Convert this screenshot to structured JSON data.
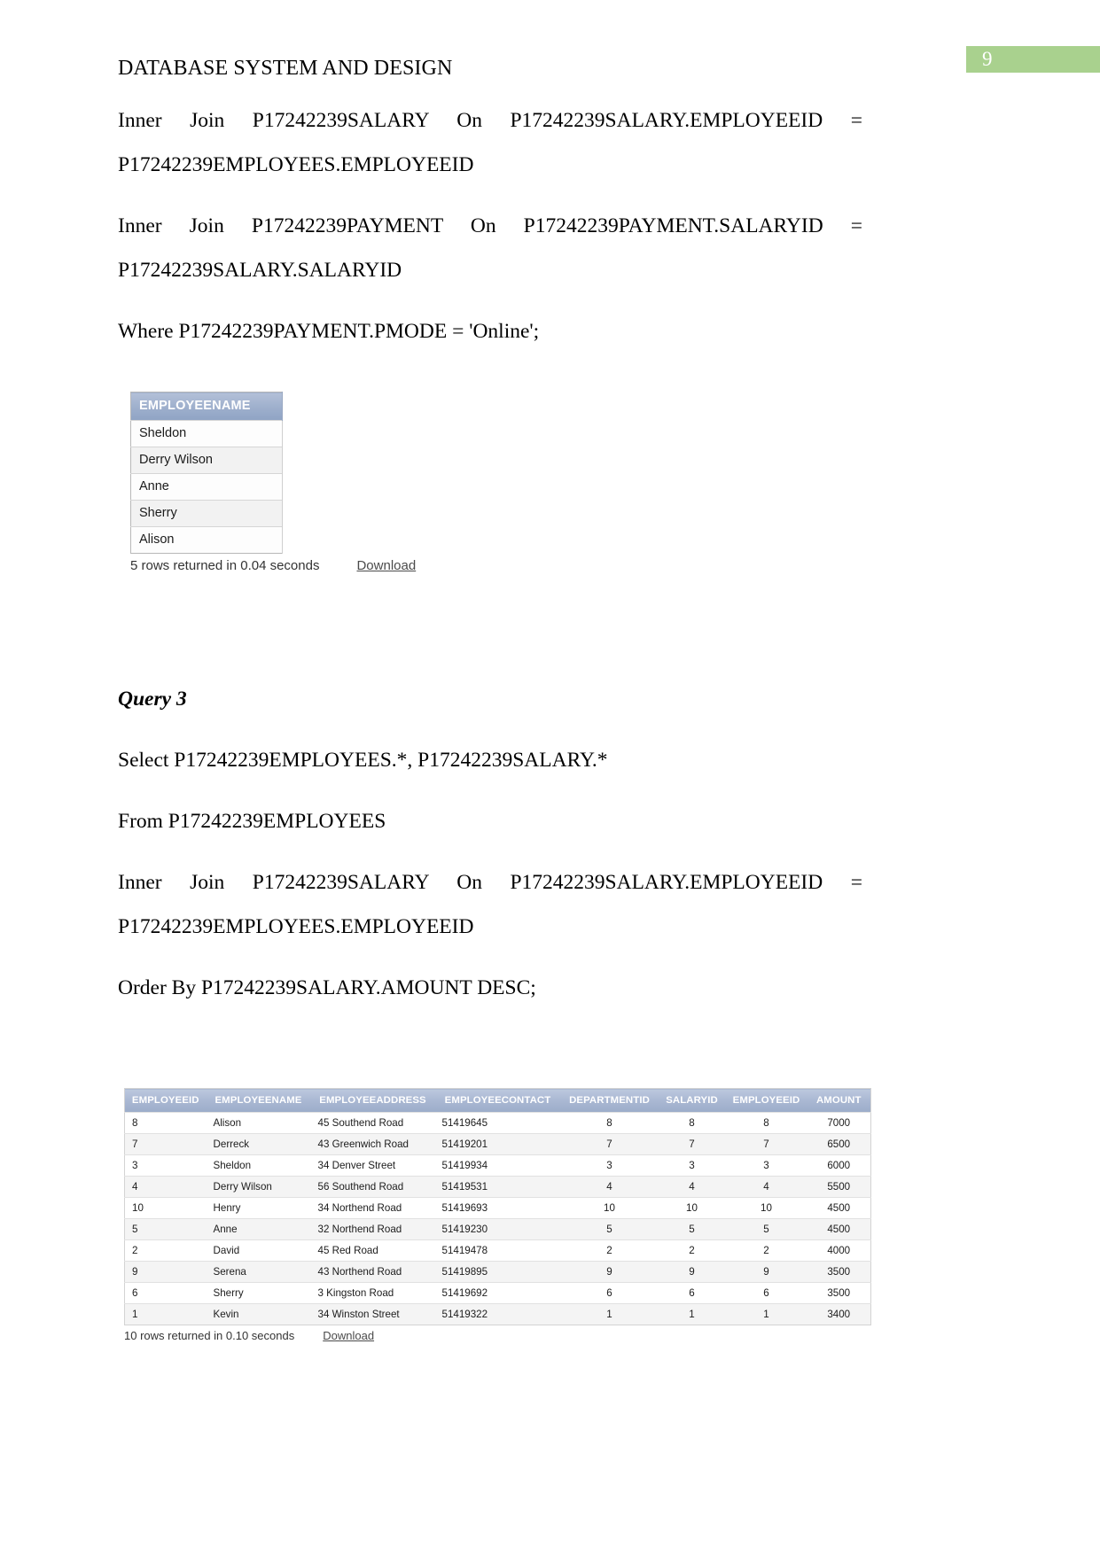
{
  "page": {
    "number": "9",
    "badge_color": "#a9d18e",
    "title": "DATABASE SYSTEM AND DESIGN"
  },
  "query2_tail": {
    "line1": "Inner Join P17242239SALARY On P17242239SALARY.EMPLOYEEID = P17242239EMPLOYEES.EMPLOYEEID",
    "line2": "Inner Join P17242239PAYMENT On P17242239PAYMENT.SALARYID = P17242239SALARY.SALARYID",
    "line3": "Where P17242239PAYMENT.PMODE = 'Online';"
  },
  "result1": {
    "columns": [
      "EMPLOYEENAME"
    ],
    "rows": [
      [
        "Sheldon"
      ],
      [
        "Derry Wilson"
      ],
      [
        "Anne"
      ],
      [
        "Sherry"
      ],
      [
        "Alison"
      ]
    ],
    "status": "5 rows returned in 0.04 seconds",
    "download_label": "Download"
  },
  "query3": {
    "heading": "Query 3",
    "line1": "Select P17242239EMPLOYEES.*, P17242239SALARY.*",
    "line2": "From P17242239EMPLOYEES",
    "line3": "Inner Join P17242239SALARY On P17242239SALARY.EMPLOYEEID = P17242239EMPLOYEES.EMPLOYEEID",
    "line4": "Order By P17242239SALARY.AMOUNT DESC;"
  },
  "result2": {
    "columns": [
      "EMPLOYEEID",
      "EMPLOYEENAME",
      "EMPLOYEEADDRESS",
      "EMPLOYEECONTACT",
      "DEPARTMENTID",
      "SALARYID",
      "EMPLOYEEID",
      "AMOUNT"
    ],
    "rows": [
      [
        "8",
        "Alison",
        "45 Southend Road",
        "51419645",
        "8",
        "8",
        "8",
        "7000"
      ],
      [
        "7",
        "Derreck",
        "43 Greenwich Road",
        "51419201",
        "7",
        "7",
        "7",
        "6500"
      ],
      [
        "3",
        "Sheldon",
        "34 Denver Street",
        "51419934",
        "3",
        "3",
        "3",
        "6000"
      ],
      [
        "4",
        "Derry Wilson",
        "56 Southend Road",
        "51419531",
        "4",
        "4",
        "4",
        "5500"
      ],
      [
        "10",
        "Henry",
        "34 Northend Road",
        "51419693",
        "10",
        "10",
        "10",
        "4500"
      ],
      [
        "5",
        "Anne",
        "32 Northend Road",
        "51419230",
        "5",
        "5",
        "5",
        "4500"
      ],
      [
        "2",
        "David",
        "45 Red Road",
        "51419478",
        "2",
        "2",
        "2",
        "4000"
      ],
      [
        "9",
        "Serena",
        "43 Northend Road",
        "51419895",
        "9",
        "9",
        "9",
        "3500"
      ],
      [
        "6",
        "Sherry",
        "3 Kingston Road",
        "51419692",
        "6",
        "6",
        "6",
        "3500"
      ],
      [
        "1",
        "Kevin",
        "34 Winston Street",
        "51419322",
        "1",
        "1",
        "1",
        "3400"
      ]
    ],
    "status": "10 rows returned in 0.10 seconds",
    "download_label": "Download"
  }
}
